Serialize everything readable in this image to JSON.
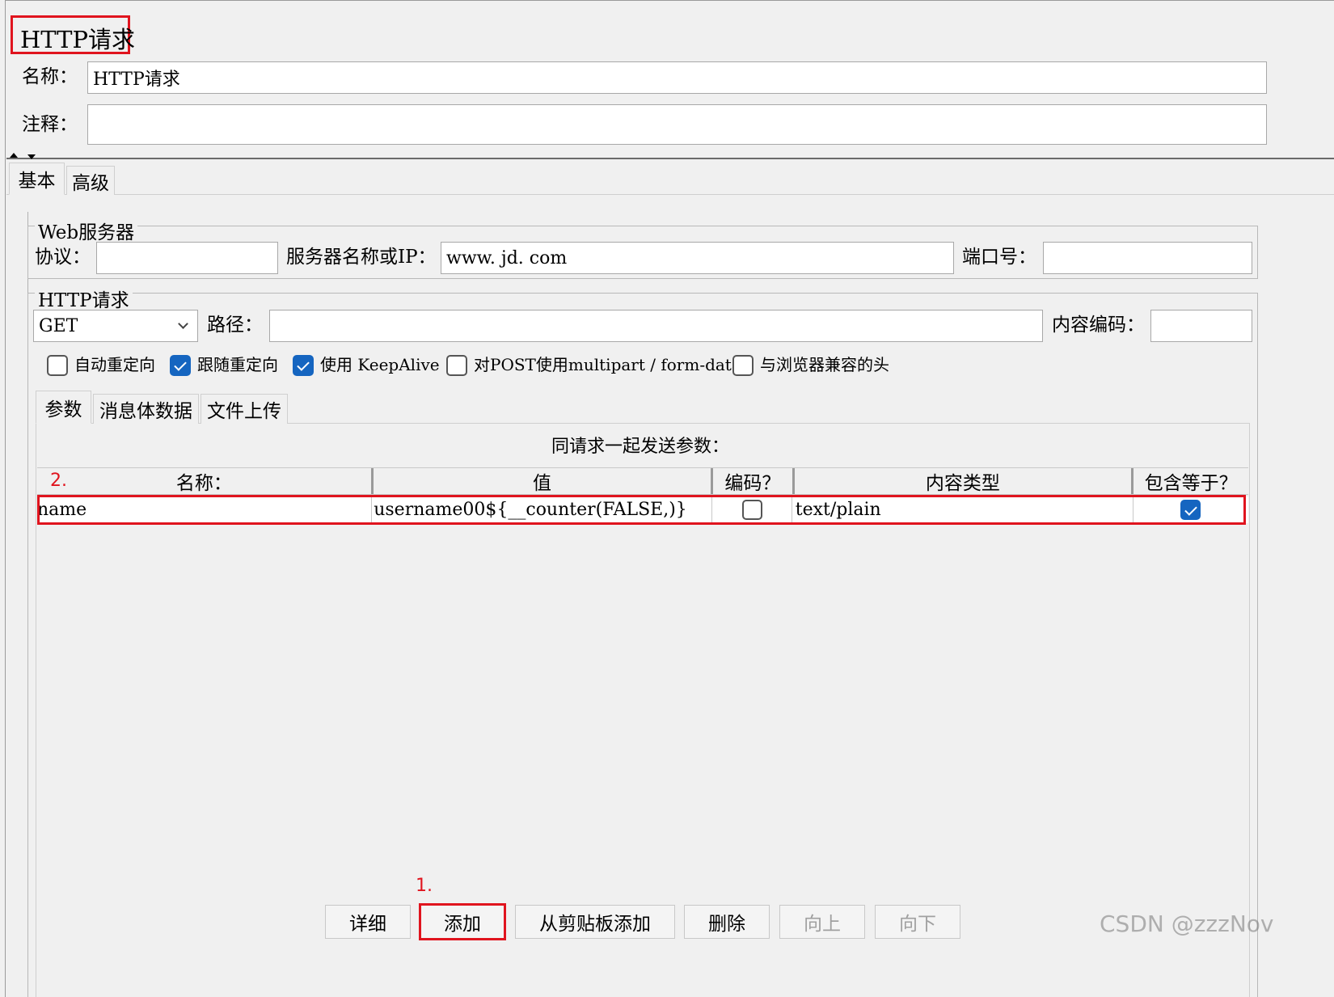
{
  "title": "HTTP请求",
  "form": {
    "name_label": "名称：",
    "name_value": "HTTP请求",
    "comment_label": "注释：",
    "comment_value": ""
  },
  "top_tabs": [
    {
      "label": "基本",
      "selected": true
    },
    {
      "label": "高级",
      "selected": false
    }
  ],
  "web_server": {
    "legend": "Web服务器",
    "protocol_label": "协议：",
    "protocol_value": "",
    "server_label": "服务器名称或IP：",
    "server_value": "www. jd. com",
    "port_label": "端口号：",
    "port_value": ""
  },
  "http_request": {
    "legend": "HTTP请求",
    "method": "GET",
    "path_label": "路径：",
    "path_value": "",
    "encoding_label": "内容编码：",
    "encoding_value": "",
    "checkboxes": [
      {
        "label": "自动重定向",
        "checked": false
      },
      {
        "label": "跟随重定向",
        "checked": true
      },
      {
        "label": "使用 KeepAlive",
        "checked": true
      },
      {
        "label": "对POST使用multipart / form-data",
        "checked": false
      },
      {
        "label": "与浏览器兼容的头",
        "checked": false
      }
    ]
  },
  "sub_tabs": [
    {
      "label": "参数",
      "selected": true
    },
    {
      "label": "消息体数据",
      "selected": false
    },
    {
      "label": "文件上传",
      "selected": false
    }
  ],
  "params": {
    "caption": "同请求一起发送参数：",
    "columns": [
      "名称：",
      "值",
      "编码？",
      "内容类型",
      "包含等于？"
    ],
    "rows": [
      {
        "name": "name",
        "value": "username00${__counter(FALSE,)}",
        "encode": false,
        "content_type": "text/plain",
        "include_equals": true
      }
    ]
  },
  "annotations": {
    "step1": "1.",
    "step2": "2."
  },
  "buttons": {
    "detail": "详细",
    "add": "添加",
    "add_clipboard": "从剪贴板添加",
    "delete": "删除",
    "up": "向上",
    "down": "向下"
  },
  "watermark": "CSDN @zzzNov",
  "colors": {
    "highlight_red": "#e0141e",
    "checkbox_blue": "#1565c0"
  }
}
